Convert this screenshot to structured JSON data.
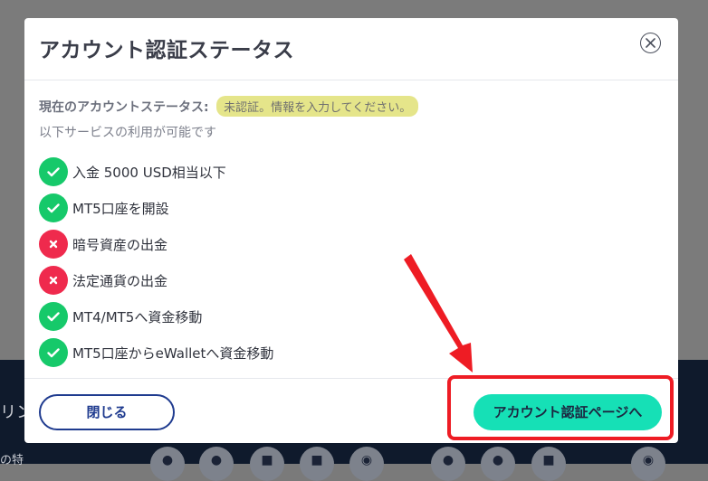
{
  "modal": {
    "title": "アカウント認証ステータス",
    "status_label": "現在のアカウントステータス:",
    "status_value": "未認証。情報を入力してください。",
    "services_note": "以下サービスの利用が可能です",
    "services": [
      {
        "label": "入金 5000 USD相当以下",
        "allowed": true
      },
      {
        "label": "MT5口座を開設",
        "allowed": true
      },
      {
        "label": "暗号資産の出金",
        "allowed": false
      },
      {
        "label": "法定通貨の出金",
        "allowed": false
      },
      {
        "label": "MT4/MT5へ資金移動",
        "allowed": true
      },
      {
        "label": "MT5口座からeWalletへ資金移動",
        "allowed": true
      }
    ],
    "close_label": "閉じる",
    "verify_label": "アカウント認証ページへ"
  },
  "background": {
    "footer_text_1": "リン",
    "footer_text_2": "の特",
    "store_icons": [
      "android-icon",
      "apple-icon",
      "windows-icon",
      "windows-icon",
      "web-icon",
      "android-icon",
      "apple-icon",
      "windows-icon",
      "web-icon"
    ]
  },
  "colors": {
    "allowed": "#16c96a",
    "denied": "#ef2a4d",
    "accent": "#16e0b6",
    "annotation": "#ee1c24"
  }
}
